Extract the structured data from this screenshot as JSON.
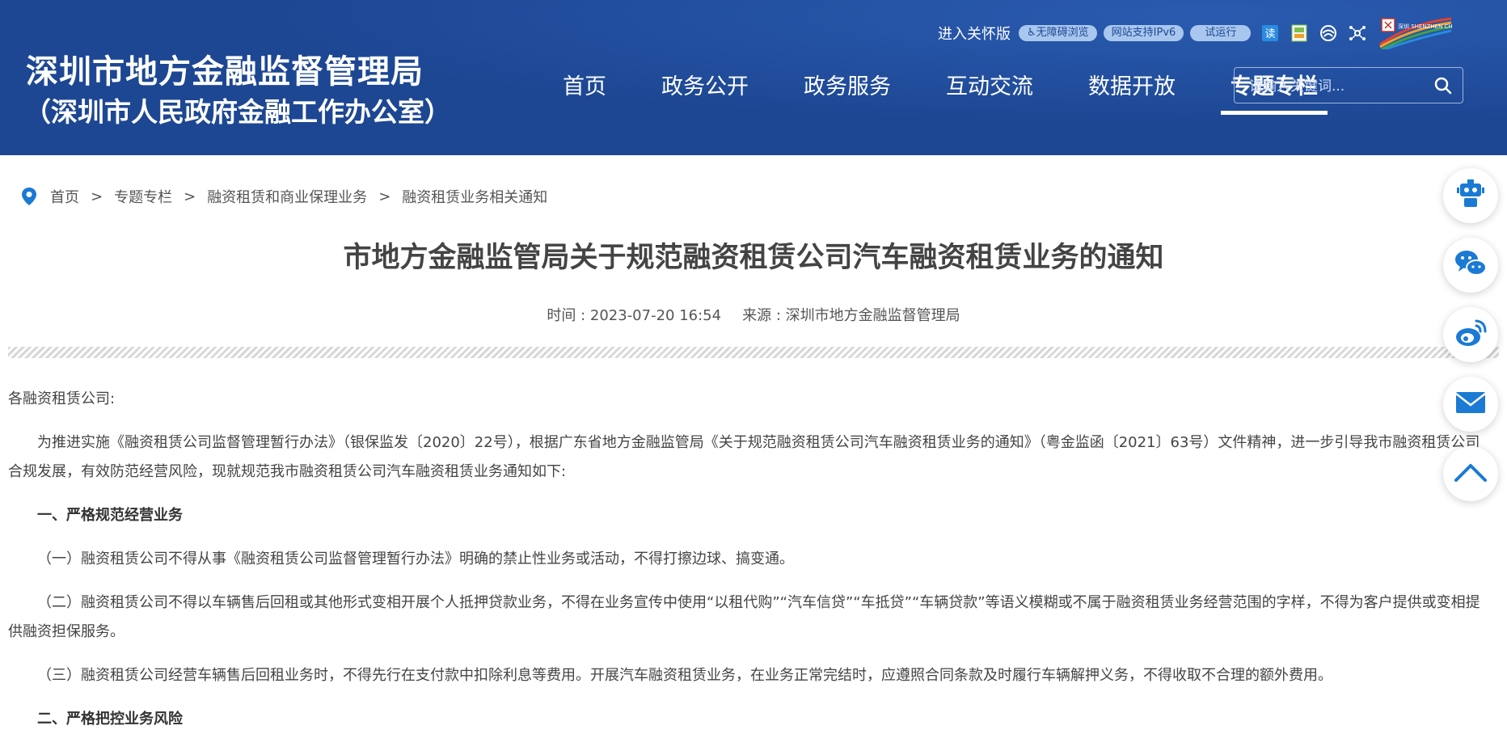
{
  "header": {
    "title": "深圳市地方金融监督管理局",
    "subtitle": "（深圳市人民政府金融工作办公室）",
    "care_version": "进入关怀版",
    "pills": [
      "无障碍浏览",
      "网站支持IPv6",
      "试运行"
    ],
    "logo_text": "深圳 SHENZHEN CHINA",
    "nav": [
      "首页",
      "政务公开",
      "政务服务",
      "互动交流",
      "数据开放",
      "专题专栏"
    ],
    "active_nav": "专题专栏",
    "search_placeholder": "请输入关键词...",
    "background_color": "#1d4793"
  },
  "breadcrumb": [
    "首页",
    "专题专栏",
    "融资租赁和商业保理业务",
    "融资租赁业务相关通知"
  ],
  "breadcrumb_separator": ">",
  "article": {
    "title": "市地方金融监管局关于规范融资租赁公司汽车融资租赁业务的通知",
    "time_label": "时间 : 2023-07-20 16:54",
    "source_label": "来源 : 深圳市地方金融监督管理局",
    "paragraphs": [
      "各融资租赁公司:",
      "为推进实施《融资租赁公司监督管理暂行办法》（银保监发〔2020〕22号），根据广东省地方金融监管局《关于规范融资租赁公司汽车融资租赁业务的通知》（粤金监函〔2021〕63号）文件精神，进一步引导我市融资租赁公司合规发展，有效防范经营风险，现就规范我市融资租赁公司汽车融资租赁业务通知如下:",
      "一、严格规范经营业务",
      "（一）融资租赁公司不得从事《融资租赁公司监督管理暂行办法》明确的禁止性业务或活动，不得打擦边球、搞变通。",
      "（二）融资租赁公司不得以车辆售后回租或其他形式变相开展个人抵押贷款业务，不得在业务宣传中使用“以租代购”“汽车信贷”“车抵贷”“车辆贷款”等语义模糊或不属于融资租赁业务经营范围的字样，不得为客户提供或变相提供融资担保服务。",
      "（三）融资租赁公司经营车辆售后回租业务时，不得先行在支付款中扣除利息等费用。开展汽车融资租赁业务，在业务正常完结时，应遵照合同条款及时履行车辆解押义务，不得收取不合理的额外费用。",
      "二、严格把控业务风险"
    ]
  },
  "side_buttons": [
    "robot-icon",
    "wechat-icon",
    "weibo-icon",
    "mail-icon",
    "back-to-top-icon"
  ],
  "accent_color": "#1a7ad4"
}
